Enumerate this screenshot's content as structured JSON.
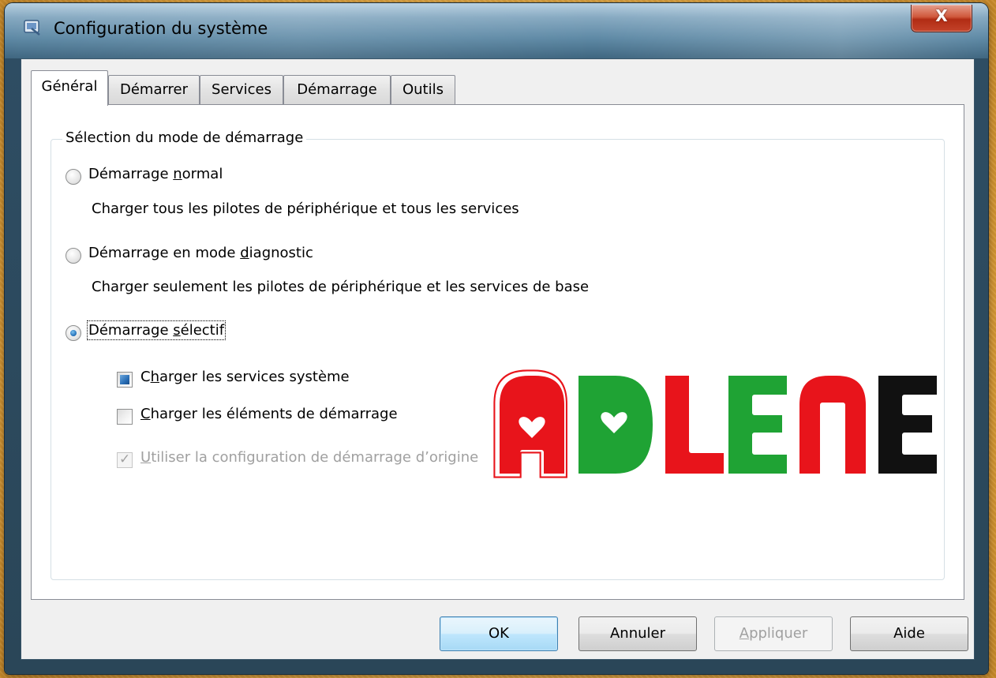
{
  "window": {
    "title": "Configuration du système",
    "close_label": "X"
  },
  "tabs": [
    {
      "label": "Général",
      "active": true
    },
    {
      "label": "Démarrer",
      "active": false
    },
    {
      "label": "Services",
      "active": false
    },
    {
      "label": "Démarrage",
      "active": false
    },
    {
      "label": "Outils",
      "active": false
    }
  ],
  "startup_group": {
    "legend": "Sélection du mode de démarrage",
    "options": [
      {
        "pre": "Démarrage ",
        "accel": "n",
        "post": "ormal",
        "description": "Charger tous les pilotes de périphérique et tous les services",
        "selected": false
      },
      {
        "pre": "Démarrage en mode ",
        "accel": "d",
        "post": "iagnostic",
        "description": "Charger seulement les pilotes de périphérique et les services de base",
        "selected": false
      },
      {
        "pre": "Démarrage ",
        "accel": "s",
        "post": "électif",
        "description": "",
        "selected": true
      }
    ],
    "selective_checks": [
      {
        "pre": "C",
        "accel": "h",
        "post": "arger les services système",
        "state": "indeterminate"
      },
      {
        "pre": "",
        "accel": "C",
        "post": "harger les éléments de démarrage",
        "state": "unchecked"
      },
      {
        "pre": "",
        "accel": "U",
        "post": "tiliser la configuration de démarrage d’origine",
        "state": "checked-disabled"
      }
    ]
  },
  "watermark": {
    "letters": [
      "A",
      "D",
      "L",
      "E",
      "N",
      "E"
    ],
    "colors": [
      "#e8141b",
      "#1fa334",
      "#e8141b",
      "#1fa334",
      "#e8141b",
      "#111111"
    ]
  },
  "buttons": {
    "ok": "OK",
    "cancel": "Annuler",
    "apply_accel": "A",
    "apply_rest": "ppliquer",
    "help": "Aide"
  }
}
